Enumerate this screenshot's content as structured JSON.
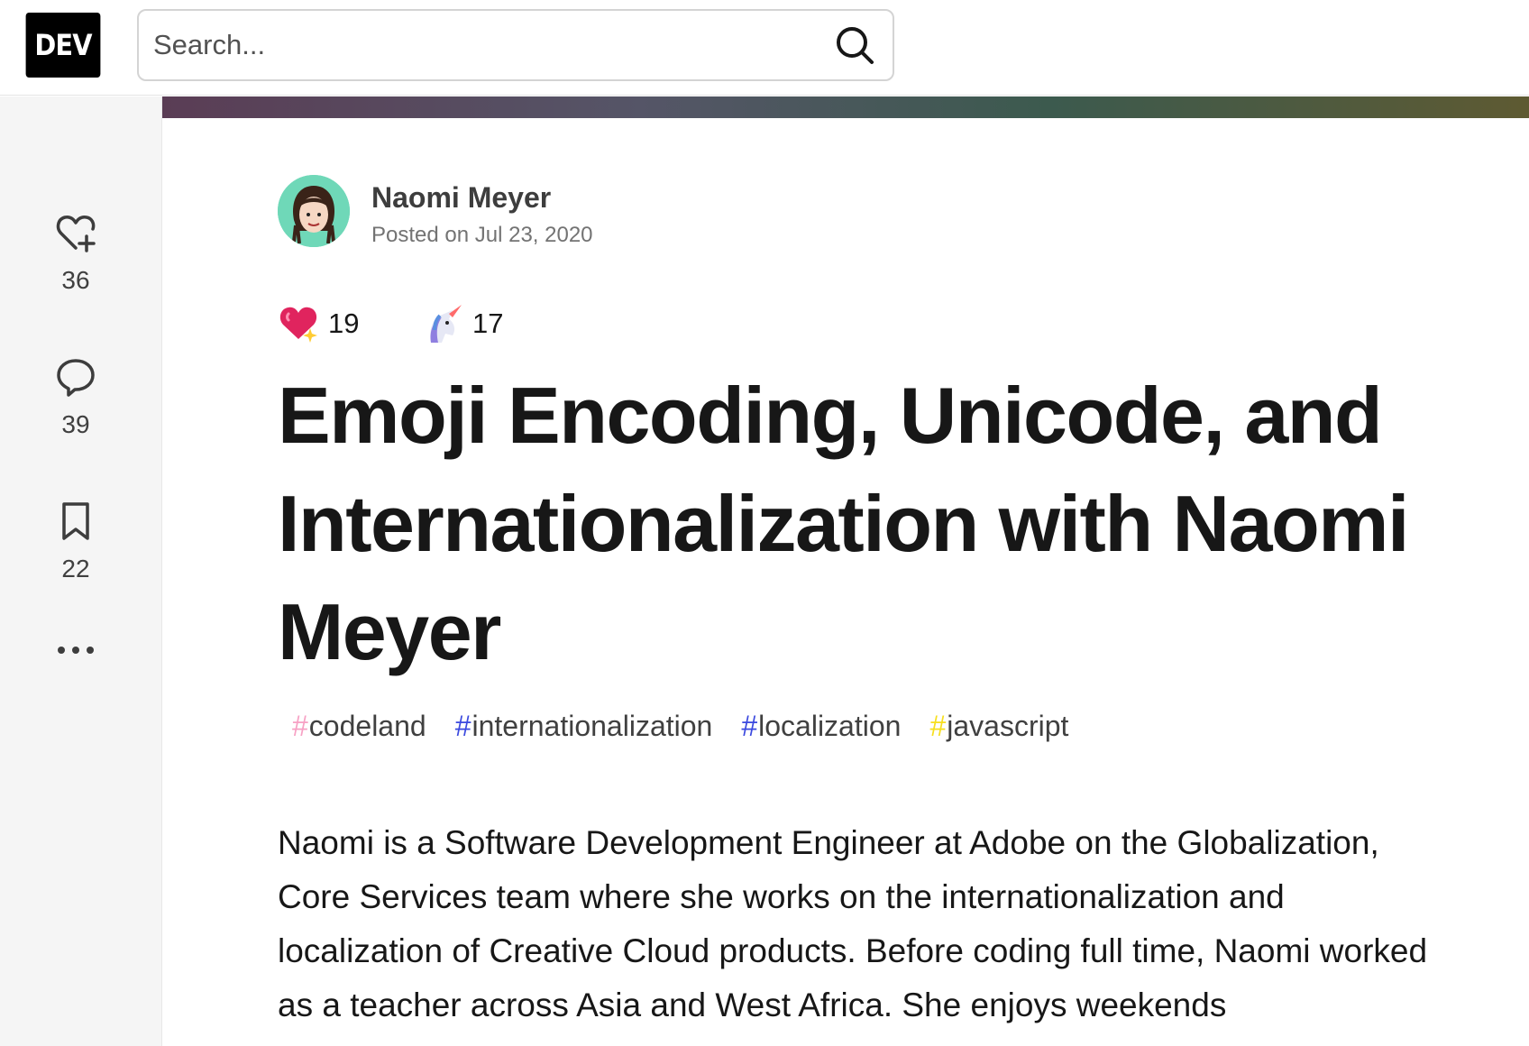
{
  "header": {
    "logo_text": "DEV",
    "search": {
      "placeholder": "Search...",
      "value": ""
    }
  },
  "sidebar": {
    "reactions_count": "36",
    "comments_count": "39",
    "bookmarks_count": "22"
  },
  "article": {
    "author_name": "Naomi Meyer",
    "posted_on": "Posted on Jul 23, 2020",
    "reactions": [
      {
        "emoji": "sparkle-heart-icon",
        "count": "19"
      },
      {
        "emoji": "unicorn-icon",
        "count": "17"
      }
    ],
    "title": "Emoji Encoding, Unicode, and Internationalization with Naomi Meyer",
    "tags": [
      {
        "hash": "#",
        "name": "codeland",
        "color": "#f7a1c4"
      },
      {
        "hash": "#",
        "name": "internationalization",
        "color": "#3b49df"
      },
      {
        "hash": "#",
        "name": "localization",
        "color": "#3b49df"
      },
      {
        "hash": "#",
        "name": "javascript",
        "color": "#f7df1e"
      }
    ],
    "body": "Naomi is a Software Development Engineer at Adobe on the Globalization, Core Services team where she works on the internationalization and localization of Creative Cloud products. Before coding full time, Naomi worked as a teacher across Asia and West Africa. She enjoys weekends"
  },
  "colors": {
    "accent": "#3b49df",
    "banner_start": "#5a3d55",
    "banner_end": "#5e5a32"
  }
}
